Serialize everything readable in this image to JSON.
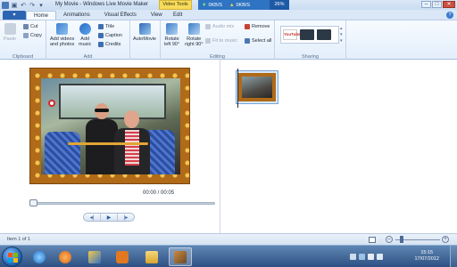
{
  "window": {
    "title": "My Movie - Windows Live Movie Maker",
    "context_tab": "Video Tools",
    "minimize": "–",
    "maximize": "□",
    "close": "✕"
  },
  "network_meter": {
    "download": "0KB/S",
    "upload": "0KB/S",
    "percent": "26%"
  },
  "tabs": {
    "file": "▾",
    "items": [
      "Home",
      "Animations",
      "Visual Effects",
      "View"
    ],
    "edit": "Edit",
    "help": "?"
  },
  "ribbon": {
    "clipboard": {
      "label": "Clipboard",
      "paste": "Paste",
      "cut": "Cut",
      "copy": "Copy"
    },
    "add": {
      "label": "Add",
      "add_videos": "Add videos\nand photos",
      "add_music": "Add\nmusic",
      "title": "Title",
      "caption": "Caption",
      "credits": "Credits"
    },
    "automovie": {
      "label": "AutoMovie"
    },
    "editing": {
      "label": "Editing",
      "rotate_left": "Rotate\nleft 90°",
      "rotate_right": "Rotate\nright 90°",
      "audio_mix": "Audio mix",
      "fit_to_music": "Fit to music",
      "remove": "Remove",
      "select_all": "Select all"
    },
    "sharing": {
      "label": "Sharing",
      "youtube": "YouTube"
    }
  },
  "player": {
    "timecode": "00:00 / 00:05",
    "progress": 0.0,
    "prev": "◂|",
    "play": "▶",
    "next": "|▸"
  },
  "status": {
    "item_text": "Item 1 of 1",
    "zoom_out": "–",
    "zoom_in": "+"
  },
  "taskbar": {
    "time": "15:15",
    "date": "17/07/2012"
  },
  "colors": {
    "accent": "#2c64b2",
    "context_tab": "#f6dc5a",
    "frame_border": "#b06a18",
    "taskbar": "#2e5183"
  }
}
